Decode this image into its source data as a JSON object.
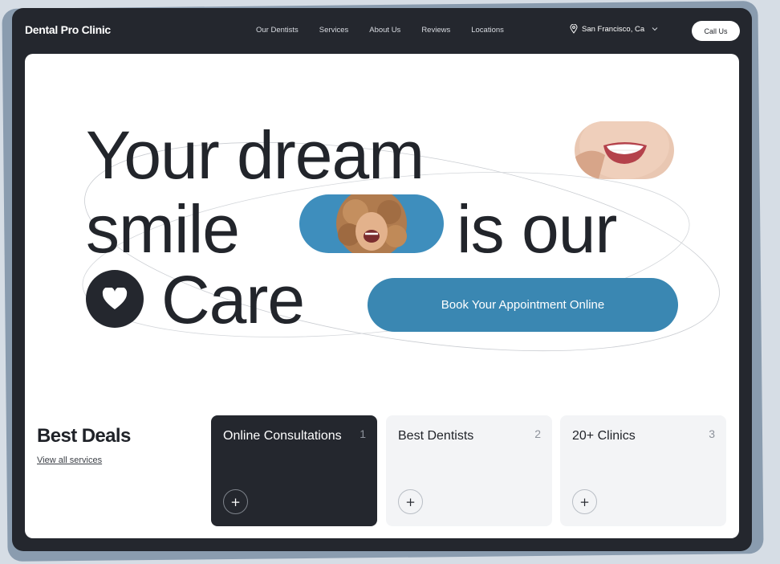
{
  "brand": "Dental Pro Clinic",
  "nav": [
    "Our Dentists",
    "Services",
    "About Us",
    "Reviews",
    "Locations"
  ],
  "location": {
    "label": "San Francisco, Ca",
    "icon": "location-pin-icon",
    "dropdown_icon": "chevron-down-icon"
  },
  "call_button": "Call Us",
  "hero": {
    "line1": "Your dream",
    "line2a": "smile",
    "line2b": "is our",
    "line3": "Care",
    "cta": "Book Your Appointment Online",
    "heart_icon": "heart-icon"
  },
  "deals": {
    "title": "Best Deals",
    "link": "View all services",
    "cards": [
      {
        "title": "Online Consultations",
        "num": "1",
        "icon": "plus-icon"
      },
      {
        "title": "Best Dentists",
        "num": "2",
        "icon": "plus-icon"
      },
      {
        "title": "20+ Clinics",
        "num": "3",
        "icon": "plus-icon"
      }
    ]
  },
  "colors": {
    "dark": "#24272e",
    "accent": "#3a87b2",
    "card_light": "#f3f4f6"
  }
}
